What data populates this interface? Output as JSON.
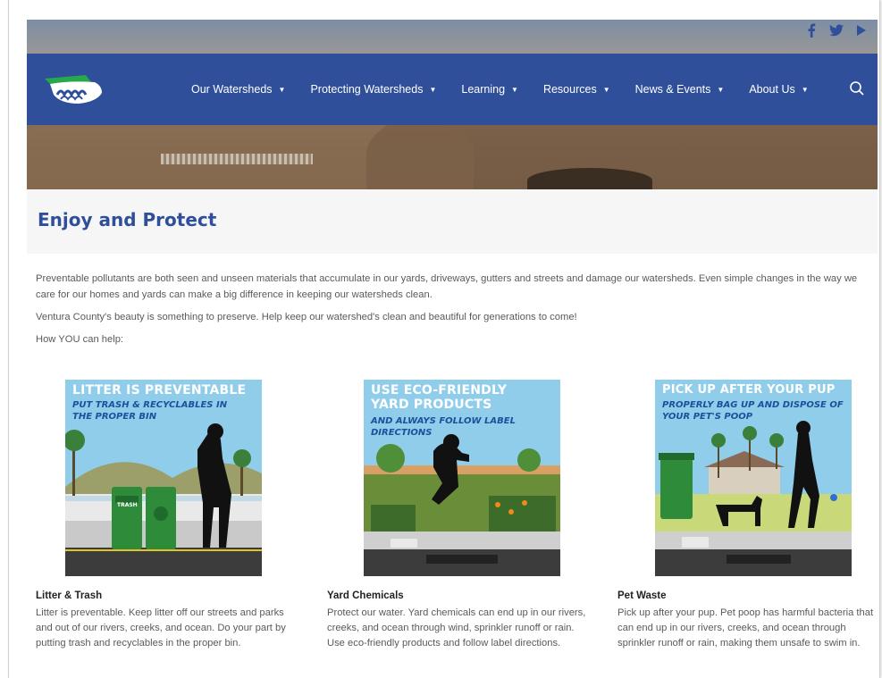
{
  "social": {
    "icons": [
      "facebook-icon",
      "twitter-icon",
      "youtube-icon"
    ]
  },
  "nav": {
    "items": [
      {
        "label": "Our Watersheds"
      },
      {
        "label": "Protecting Watersheds"
      },
      {
        "label": "Learning"
      },
      {
        "label": "Resources"
      },
      {
        "label": "News & Events"
      },
      {
        "label": "About Us"
      }
    ],
    "search_icon": "search-icon"
  },
  "page": {
    "title": "Enjoy and Protect",
    "paragraphs": [
      "Preventable pollutants are both seen and unseen materials that accumulate in our yards, driveways, gutters and streets and damage our watersheds. Even simple changes in the way we care for our homes and yards can make a big difference in keeping our watersheds clean.",
      "Ventura County's beauty is something to preserve. Help keep our watershed's clean and beautiful for generations to come!",
      "How YOU can help:"
    ]
  },
  "cards": [
    {
      "image_heading": "LITTER IS PREVENTABLE",
      "image_subheading": "PUT TRASH & RECYCLABLES IN THE PROPER BIN",
      "bin_label": "TRASH",
      "title": "Litter & Trash",
      "text": "Litter is preventable. Keep litter off our streets and parks and out of our rivers, creeks, and ocean. Do your part by putting trash and recyclables in the proper bin."
    },
    {
      "image_heading": "USE ECO-FRIENDLY YARD PRODUCTS",
      "image_subheading": "AND ALWAYS FOLLOW LABEL DIRECTIONS",
      "title": "Yard Chemicals",
      "text": "Protect our water. Yard chemicals can end up in our rivers, creeks, and ocean through wind, sprinkler runoff or rain. Use eco-friendly products and follow label directions."
    },
    {
      "image_heading": "PICK UP AFTER YOUR PUP",
      "image_subheading": "PROPERLY BAG UP AND DISPOSE OF YOUR PET'S POOP",
      "title": "Pet Waste",
      "text": "Pick up after your pup. Pet poop has harmful bacteria that can end up in our rivers, creeks, and ocean through sprinkler runoff or rain, making them unsafe to swim in."
    }
  ],
  "colors": {
    "brand_blue": "#2f4f9b",
    "logo_green": "#27a84a"
  }
}
